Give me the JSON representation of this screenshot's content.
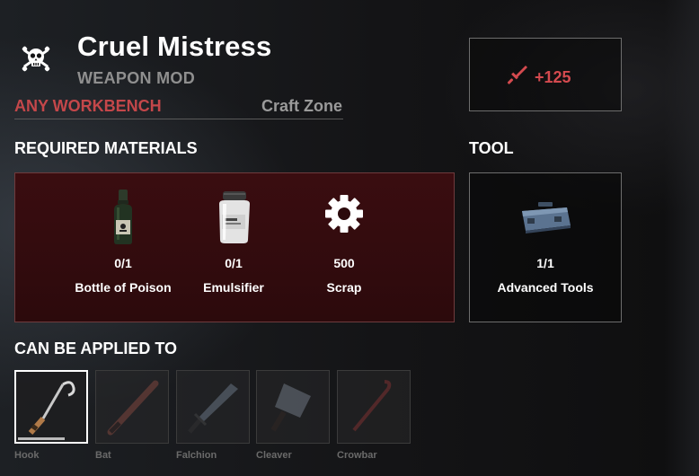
{
  "header": {
    "icon": "skull-crossbones-icon",
    "title": "Cruel Mistress",
    "subtitle": "WEAPON MOD",
    "workbench": "ANY WORKBENCH",
    "craft_zone": "Craft Zone"
  },
  "bonus": {
    "icon": "sword-icon",
    "value": "+125",
    "color": "#d44a4f"
  },
  "sections": {
    "required": "REQUIRED MATERIALS",
    "tool": "TOOL",
    "applied": "CAN BE APPLIED TO"
  },
  "materials": [
    {
      "icon": "poison-bottle-icon",
      "count": "0/1",
      "name": "Bottle of Poison"
    },
    {
      "icon": "emulsifier-jar-icon",
      "count": "0/1",
      "name": "Emulsifier"
    },
    {
      "icon": "scrap-gear-icon",
      "count": "500",
      "name": "Scrap"
    }
  ],
  "tool": {
    "icon": "toolbox-icon",
    "count": "1/1",
    "name": "Advanced Tools"
  },
  "applied": [
    {
      "icon": "hook-icon",
      "label": "Hook",
      "selected": true
    },
    {
      "icon": "bat-icon",
      "label": "Bat",
      "selected": false
    },
    {
      "icon": "falchion-icon",
      "label": "Falchion",
      "selected": false
    },
    {
      "icon": "cleaver-icon",
      "label": "Cleaver",
      "selected": false
    },
    {
      "icon": "crowbar-icon",
      "label": "Crowbar",
      "selected": false
    }
  ],
  "colors": {
    "accent_red": "#c4474a",
    "panel_red": "#2c0a0c"
  }
}
